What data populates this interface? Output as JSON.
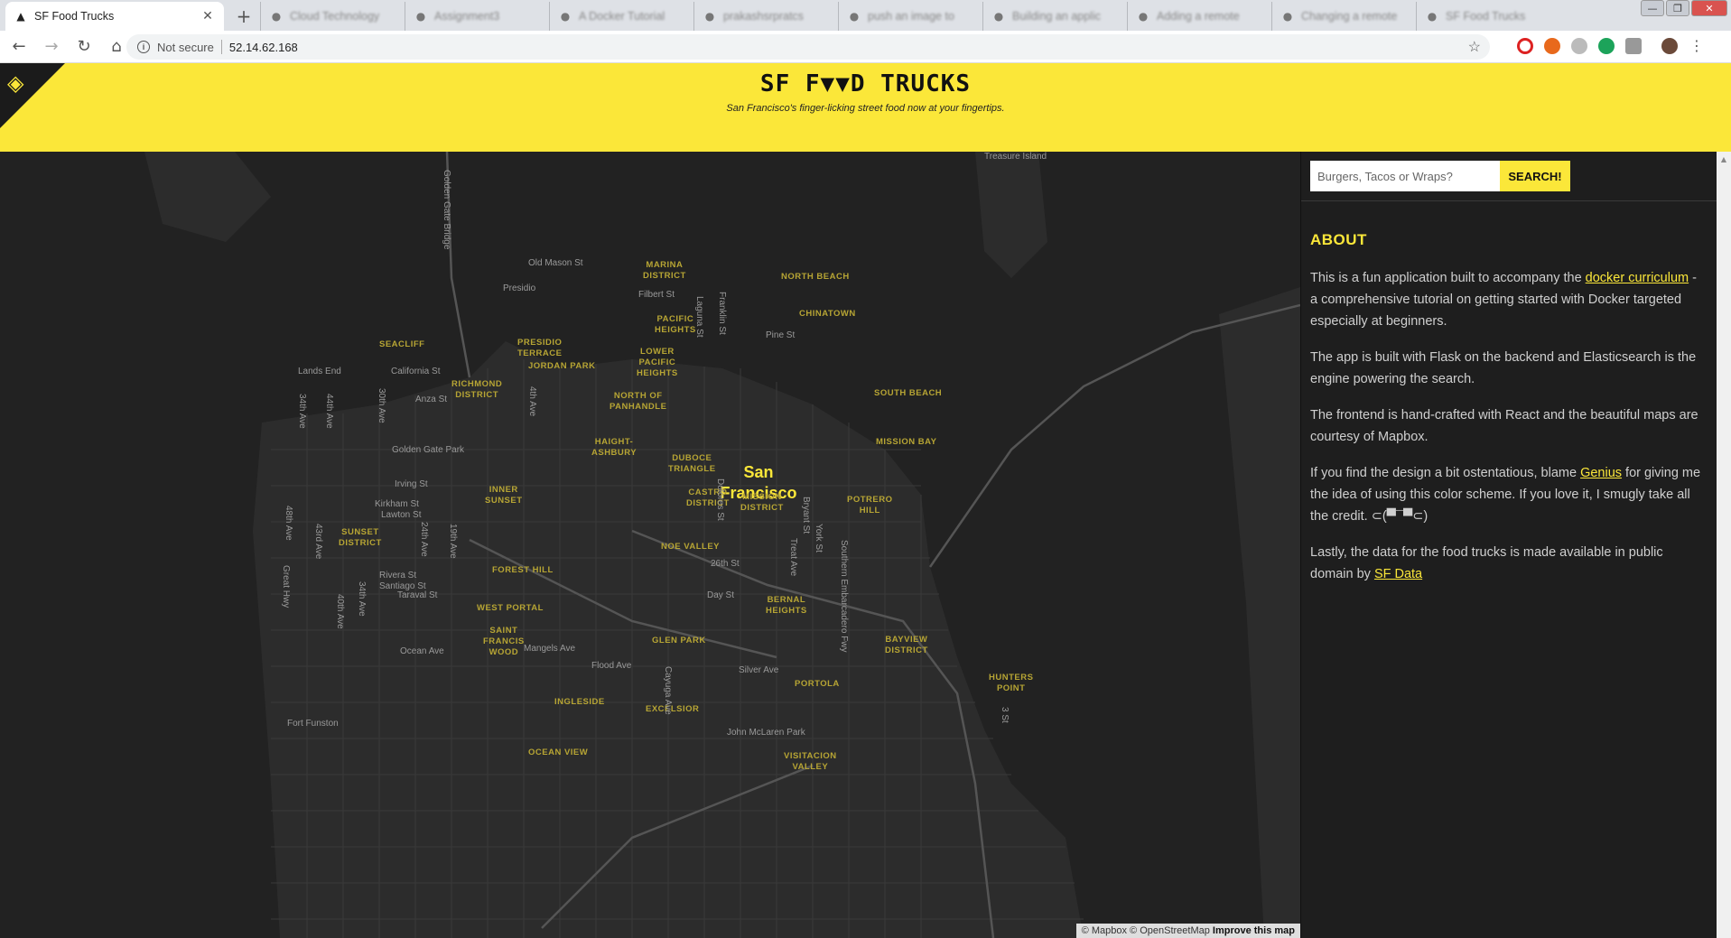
{
  "browser": {
    "active_tab": {
      "title": "SF Food Trucks",
      "favicon": "truck-icon"
    },
    "background_tabs": [
      "Cloud Technology",
      "Assignment3",
      "A Docker Tutorial",
      "prakashsrpratcs",
      "push an image to",
      "Building an applic",
      "Adding a remote",
      "Changing a remote",
      "SF Food Trucks"
    ],
    "address": {
      "security_label": "Not secure",
      "url": "52.14.62.168"
    }
  },
  "header": {
    "title": "SF F▼▼D TRUCKS",
    "subtitle": "San Francisco's finger-licking street food now at your fingertips."
  },
  "map": {
    "city": "San\nFrancisco",
    "neighborhoods": [
      "MARINA\nDISTRICT",
      "NORTH BEACH",
      "PACIFIC\nHEIGHTS",
      "CHINATOWN",
      "SEACLIFF",
      "PRESIDIO\nTERRACE",
      "JORDAN PARK",
      "LOWER\nPACIFIC\nHEIGHTS",
      "RICHMOND\nDISTRICT",
      "NORTH OF\nPANHANDLE",
      "SOUTH BEACH",
      "HAIGHT-\nASHBURY",
      "MISSION BAY",
      "DUBOCE\nTRIANGLE",
      "INNER\nSUNSET",
      "CASTRO\nDISTRICT",
      "MISSION\nDISTRICT",
      "POTRERO\nHILL",
      "SUNSET\nDISTRICT",
      "NOE VALLEY",
      "FOREST HILL",
      "BERNAL\nHEIGHTS",
      "WEST PORTAL",
      "SAINT\nFRANCIS\nWOOD",
      "BAYVIEW\nDISTRICT",
      "GLEN PARK",
      "HUNTERS\nPOINT",
      "PORTOLA",
      "INGLESIDE",
      "EXCELSIOR",
      "OCEAN VIEW",
      "VISITACION\nVALLEY"
    ],
    "streets": [
      "Treasure Island",
      "Golden Gate Bridge",
      "Old Mason St",
      "Presidio",
      "Filbert St",
      "Laguna St",
      "Franklin St",
      "Pine St",
      "Lands End",
      "California St",
      "Anza St",
      "34th Ave",
      "44th Ave",
      "30th Ave",
      "4th Ave",
      "Golden Gate Park",
      "Irving St",
      "Kirkham St",
      "Lawton St",
      "48th Ave",
      "43rd Ave",
      "24th Ave",
      "19th Ave",
      "Dolores St",
      "Bryant St",
      "York St",
      "Treat Ave",
      "26th St",
      "Day St",
      "Great Hwy",
      "Rivera St",
      "Santiago St",
      "Taraval St",
      "34th Ave",
      "40th Ave",
      "Southern Embarcadero Fwy",
      "Ocean Ave",
      "Mangels Ave",
      "Flood Ave",
      "Silver Ave",
      "Cayuga Ave",
      "Fort Funston",
      "John McLaren Park",
      "3 St"
    ],
    "attribution": {
      "mapbox": "© Mapbox",
      "osm": "© OpenStreetMap",
      "improve": "Improve this map"
    }
  },
  "sidebar": {
    "search": {
      "placeholder": "Burgers, Tacos or Wraps?",
      "button": "SEARCH!"
    },
    "about_title": "ABOUT",
    "p1_pre": "This is a fun application built to accompany the ",
    "p1_link": "docker curriculum",
    "p1_post": " - a comprehensive tutorial on getting started with Docker targeted especially at beginners.",
    "p2": "The app is built with Flask on the backend and Elasticsearch is the engine powering the search.",
    "p3": "The frontend is hand-crafted with React and the beautiful maps are courtesy of Mapbox.",
    "p4_pre": "If you find the design a bit ostentatious, blame ",
    "p4_link": "Genius",
    "p4_post": " for giving me the idea of using this color scheme. If you love it, I smugly take all the credit. ⊂(▀¯▀⊂)",
    "p5_pre": "Lastly, the data for the food trucks is made available in public domain by ",
    "p5_link": "SF Data"
  },
  "colors": {
    "accent": "#fbe739",
    "map_bg": "#222222",
    "land": "#2b2b2b",
    "water": "#1a1a1a"
  }
}
